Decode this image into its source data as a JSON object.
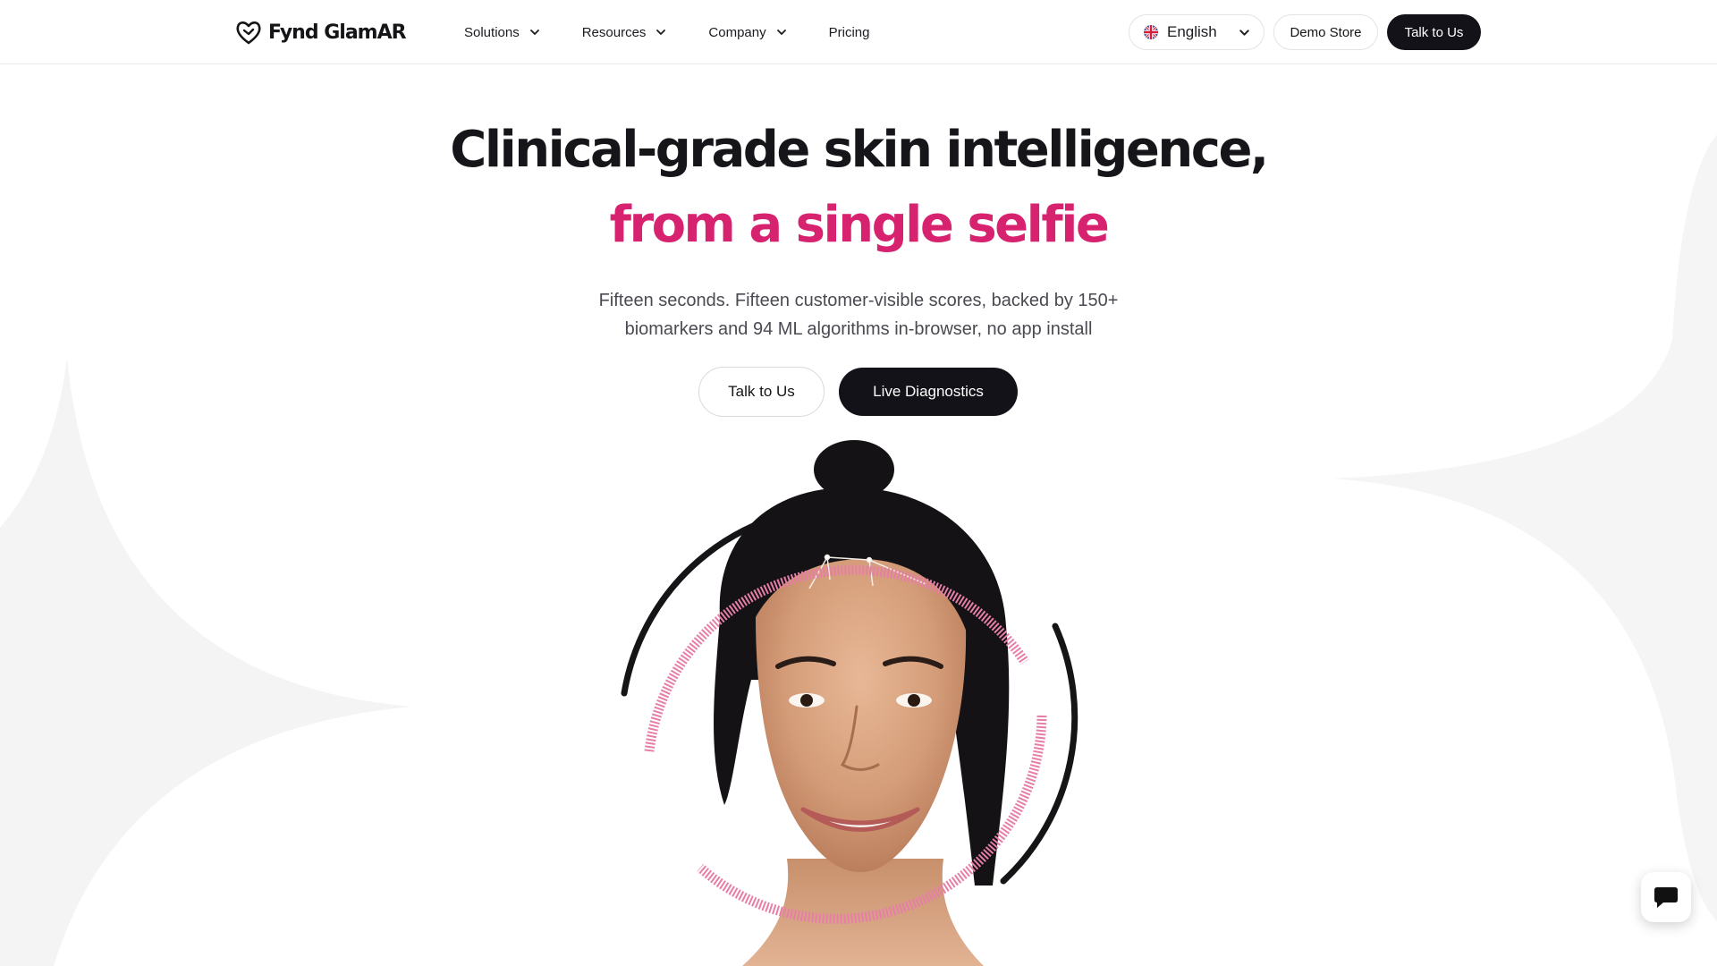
{
  "brand": {
    "name": "Fynd GlamAR",
    "logo_icon": "heart-face-logo-icon"
  },
  "nav": {
    "menu": [
      {
        "label": "Solutions",
        "has_dropdown": true
      },
      {
        "label": "Resources",
        "has_dropdown": true
      },
      {
        "label": "Company",
        "has_dropdown": true
      },
      {
        "label": "Pricing",
        "has_dropdown": false
      }
    ],
    "language": {
      "label": "English",
      "icon": "uk-flag-icon"
    },
    "demo_store": "Demo Store",
    "talk_to_us": "Talk to Us"
  },
  "hero": {
    "title_line1": "Clinical-grade skin intelligence,",
    "title_line2": "from a single selfie",
    "subtitle_line1": "Fifteen seconds. Fifteen customer-visible scores, backed by 150+",
    "subtitle_line2": "biomarkers and 94 ML algorithms in-browser, no app install",
    "cta_secondary": "Talk to Us",
    "cta_primary": "Live Diagnostics"
  },
  "colors": {
    "accent": "#d6226f",
    "dark": "#121218",
    "ring_pink": "#e77ea8",
    "background_shape": "#f4f4f5"
  },
  "chat": {
    "icon": "chat-bubble-icon"
  }
}
